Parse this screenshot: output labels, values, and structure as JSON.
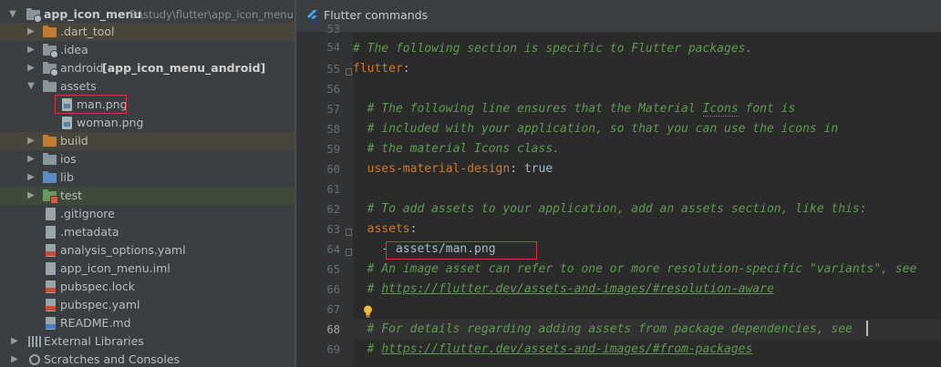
{
  "project_tree": {
    "root": {
      "name": "app_icon_menu",
      "path": "E:\\study\\flutter\\app_icon_menu"
    },
    "items": [
      {
        "label": ".dart_tool"
      },
      {
        "label": ".idea"
      },
      {
        "label": "android",
        "module": "[app_icon_menu_android]"
      },
      {
        "label": "assets"
      },
      {
        "label": "man.png"
      },
      {
        "label": "woman.png"
      },
      {
        "label": "build"
      },
      {
        "label": "ios"
      },
      {
        "label": "lib"
      },
      {
        "label": "test"
      },
      {
        "label": ".gitignore"
      },
      {
        "label": ".metadata"
      },
      {
        "label": "analysis_options.yaml"
      },
      {
        "label": "app_icon_menu.iml"
      },
      {
        "label": "pubspec.lock"
      },
      {
        "label": "pubspec.yaml"
      },
      {
        "label": "README.md"
      }
    ],
    "external_libraries": "External Libraries",
    "scratches": "Scratches and Consoles"
  },
  "editor": {
    "banner_title": "Flutter commands",
    "line_numbers": [
      "53",
      "54",
      "55",
      "56",
      "57",
      "58",
      "59",
      "60",
      "61",
      "62",
      "63",
      "64",
      "65",
      "66",
      "67",
      "68",
      "69"
    ],
    "current_line": "68",
    "lines": {
      "l54": "# The following section is specific to Flutter packages.",
      "l55_key": "flutter",
      "l55_colon": ":",
      "l57_a": "  # The following line ensures that the Material ",
      "l57_b": "Icons",
      "l57_c": " font is",
      "l58": "  # included with your application, so that you can use the icons in",
      "l59": "  # the material Icons class.",
      "l60_key": "  uses-material-design",
      "l60_val": ": true",
      "l62": "  # To add assets to your application, add an assets section, like this:",
      "l63_key": "  assets",
      "l63_colon": ":",
      "l64": "    - assets/man.png",
      "l65": "  # An image asset can refer to one or more resolution-specific \"variants\", see",
      "l66_hash": "  # ",
      "l66_link": "https://flutter.dev/assets-and-images/#resolution-aware",
      "l68": "  # For details regarding adding assets from package dependencies, see",
      "l69_hash": "  # ",
      "l69_link": "https://flutter.dev/assets-and-images/#from-packages"
    }
  },
  "colors": {
    "highlight_box": "#d9333f",
    "comment": "#629755",
    "keyword": "#cc7832",
    "editor_bg": "#2b2b2b",
    "panel_bg": "#3c3f41"
  },
  "icons": [
    "folder-icon",
    "file-icon",
    "yaml-file-icon",
    "markdown-file-icon",
    "image-file-icon",
    "library-icon",
    "scratches-icon",
    "flutter-icon",
    "lightbulb-icon",
    "chevron-right-icon",
    "chevron-down-icon"
  ]
}
